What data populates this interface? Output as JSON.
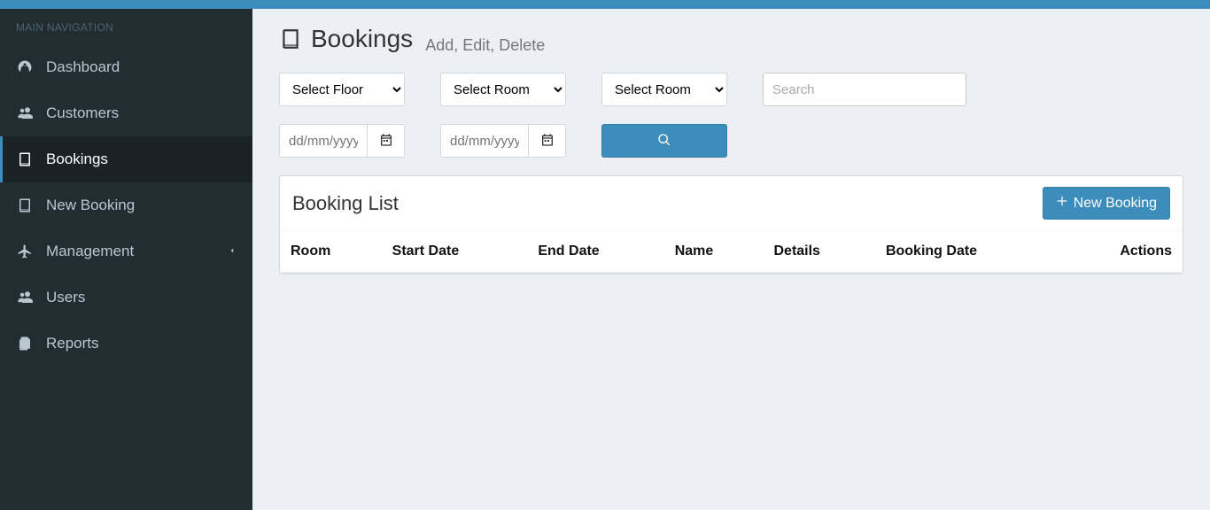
{
  "sidebar": {
    "header": "MAIN NAVIGATION",
    "items": [
      {
        "label": "Dashboard",
        "active": false
      },
      {
        "label": "Customers",
        "active": false
      },
      {
        "label": "Bookings",
        "active": true
      },
      {
        "label": "New Booking",
        "active": false
      },
      {
        "label": "Management",
        "active": false,
        "hasSubmenu": true
      },
      {
        "label": "Users",
        "active": false
      },
      {
        "label": "Reports",
        "active": false
      }
    ]
  },
  "page": {
    "title": "Bookings",
    "subtitle": "Add, Edit, Delete"
  },
  "filters": {
    "floor_placeholder": "Select Floor",
    "room1_placeholder": "Select Room",
    "room2_placeholder": "Select Room",
    "search_placeholder": "Search",
    "date_placeholder": "dd/mm/yyyy"
  },
  "panel": {
    "title": "Booking List",
    "new_button": "New Booking"
  },
  "table": {
    "columns": [
      "Room",
      "Start Date",
      "End Date",
      "Name",
      "Details",
      "Booking Date",
      "Actions"
    ],
    "rows": []
  }
}
